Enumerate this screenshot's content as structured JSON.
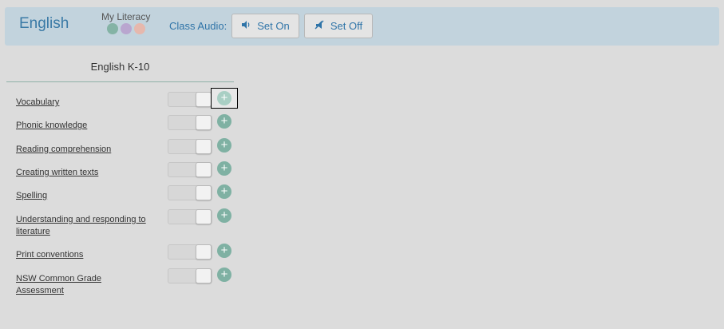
{
  "header": {
    "title": "English",
    "literacy_label": "My Literacy",
    "literacy_dots": [
      "#84b3a5",
      "#b9a6cf",
      "#e6b8ad"
    ],
    "class_audio_label": "Class Audio:",
    "set_on_label": "Set On",
    "set_off_label": "Set Off"
  },
  "panel": {
    "title": "English K-10",
    "items": [
      {
        "label": "Vocabulary"
      },
      {
        "label": "Phonic knowledge"
      },
      {
        "label": "Reading comprehension"
      },
      {
        "label": "Creating written texts"
      },
      {
        "label": "Spelling"
      },
      {
        "label": "Understanding and responding to literature"
      },
      {
        "label": "Print conventions"
      },
      {
        "label": "NSW Common Grade Assessment"
      }
    ]
  },
  "colors": {
    "accent": "#3a7aa6",
    "plus": "#7fb1a3"
  },
  "icons": {
    "set_on": "speaker-icon",
    "set_off": "mute-icon",
    "add": "plus-circle-icon"
  }
}
